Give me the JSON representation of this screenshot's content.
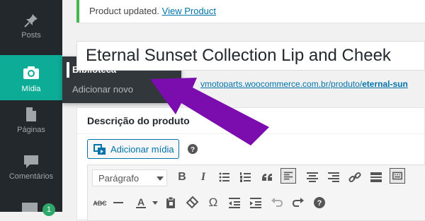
{
  "sidebar": {
    "items": [
      {
        "label": "Posts",
        "icon": "pin-icon"
      },
      {
        "label": "Mídia",
        "icon": "camera-icon"
      },
      {
        "label": "Páginas",
        "icon": "page-icon"
      },
      {
        "label": "Comentários",
        "icon": "comment-icon"
      }
    ],
    "badge_count": "1",
    "active_color": "#0dac96"
  },
  "flyout": {
    "items": [
      {
        "label": "Biblioteca"
      },
      {
        "label": "Adicionar novo"
      }
    ]
  },
  "annotation": {
    "arrow_color": "#7b0cae"
  },
  "notice": {
    "text": "Product updated.",
    "link": "View Product"
  },
  "product": {
    "title": "Eternal Sunset Collection Lip and Cheek",
    "permalink_prefix": "vmotoparts.woocommerce.com.br/produto/",
    "permalink_slug": "eternal-sun"
  },
  "editor": {
    "section_title": "Descrição do produto",
    "add_media_label": "Adicionar mídia",
    "format_select": "Parágrafo"
  }
}
